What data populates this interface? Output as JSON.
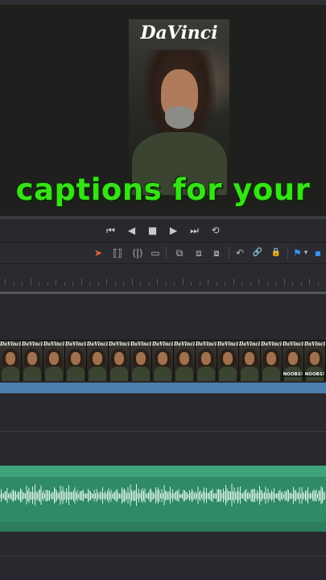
{
  "viewer": {
    "logo": "DaVinci",
    "caption": "captions for your"
  },
  "transport": {
    "buttons": [
      "⏮",
      "◀",
      "■",
      "▶",
      "⏭",
      "⟲"
    ]
  },
  "toolbar": {
    "tools": [
      {
        "name": "selection-tool-icon",
        "glyph": "➤"
      },
      {
        "name": "trim-tool-icon",
        "glyph": "⟦⟧"
      },
      {
        "name": "dynamic-trim-icon",
        "glyph": "⟨|⟩"
      },
      {
        "name": "blade-tool-icon",
        "glyph": "▭"
      },
      {
        "name": "insert-clip-icon",
        "glyph": "⧉"
      },
      {
        "name": "overwrite-clip-icon",
        "glyph": "⧈"
      },
      {
        "name": "replace-clip-icon",
        "glyph": "⧇"
      },
      {
        "name": "snapping-icon",
        "glyph": "↶"
      },
      {
        "name": "linked-selection-icon",
        "glyph": "🔗"
      },
      {
        "name": "position-lock-icon",
        "glyph": "🔒"
      },
      {
        "name": "flag-icon",
        "glyph": "⚑"
      },
      {
        "name": "marker-icon",
        "glyph": "▾"
      }
    ]
  },
  "timeline": {
    "clip_text": {
      "logo": "DaVinci",
      "overlay": "NOOBS!"
    },
    "colors": {
      "video_clip": "#141414",
      "subtitle_clip": "#4d7fae",
      "audio_clip": "#2f8a66",
      "selection_accent": "#e8663a"
    }
  }
}
